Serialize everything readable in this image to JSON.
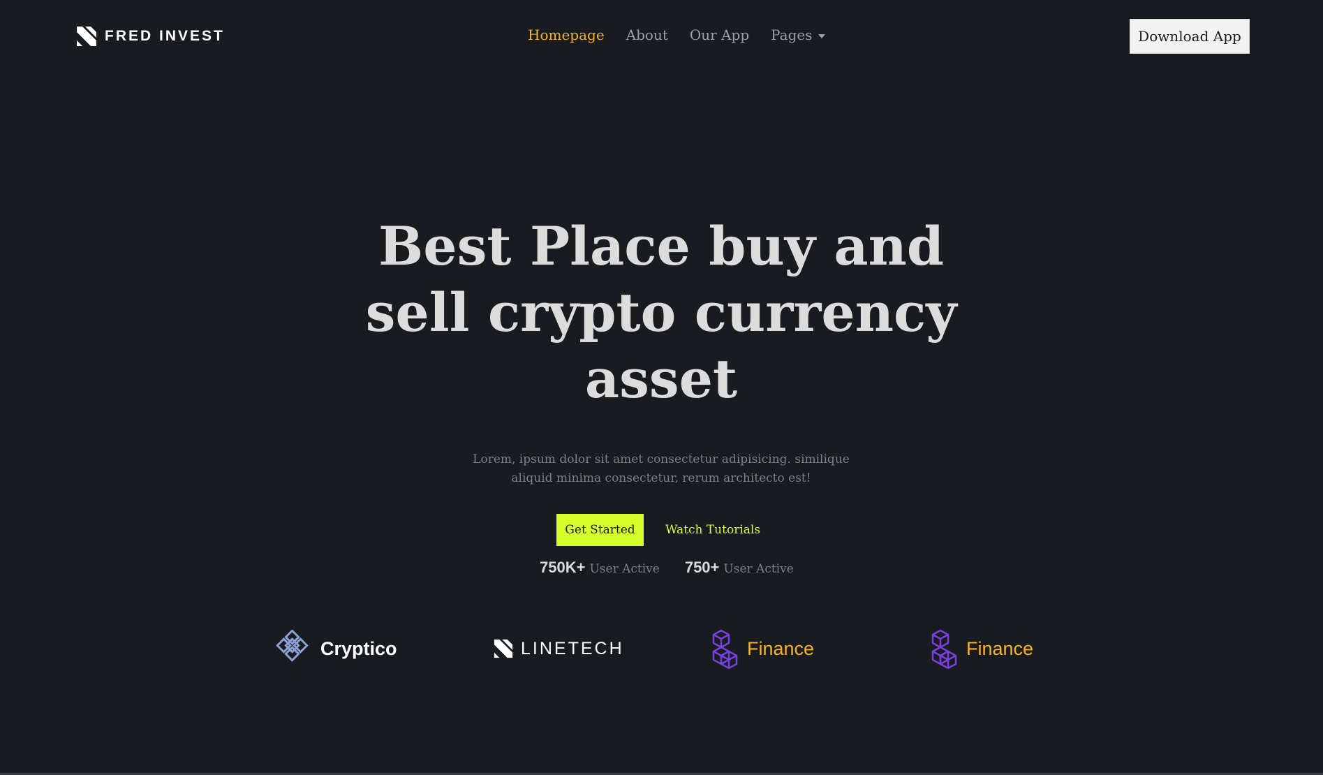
{
  "brand": {
    "name": "FRED INVEST",
    "logo_icon": "fred-invest-logo-icon"
  },
  "nav": {
    "links": [
      {
        "label": "Homepage",
        "active": true
      },
      {
        "label": "About",
        "active": false
      },
      {
        "label": "Our App",
        "active": false
      },
      {
        "label": "Pages",
        "active": false,
        "dropdown": true
      }
    ],
    "download_label": "Download App"
  },
  "hero": {
    "title_lines": [
      "Best Place buy and",
      "sell crypto currency",
      "asset"
    ],
    "subtitle_lines": [
      "Lorem, ipsum dolor sit amet consectetur adipisicing. similique",
      "aliquid minima consectetur, rerum architecto est!"
    ],
    "primary_cta": "Get Started",
    "secondary_cta": "Watch Tutorials",
    "stats": [
      {
        "value": "750K+",
        "label": "User Active"
      },
      {
        "value": "750+",
        "label": "User Active"
      }
    ]
  },
  "partners": [
    {
      "name": "Cryptico",
      "icon": "knot-icon",
      "color": "#ffffff"
    },
    {
      "name": "LINETECH",
      "icon": "linetech-logo-icon",
      "color": "#ffffff"
    },
    {
      "name": "Finance",
      "icon": "cube-stack-icon",
      "color": "#f5b324"
    },
    {
      "name": "Finance",
      "icon": "cube-stack-icon",
      "color": "#f5b324"
    }
  ],
  "colors": {
    "background": "#181b1f",
    "accent_yellow": "#f5b324",
    "accent_lime": "#d6ff2b",
    "partner_purple": "#7a3fe0"
  }
}
